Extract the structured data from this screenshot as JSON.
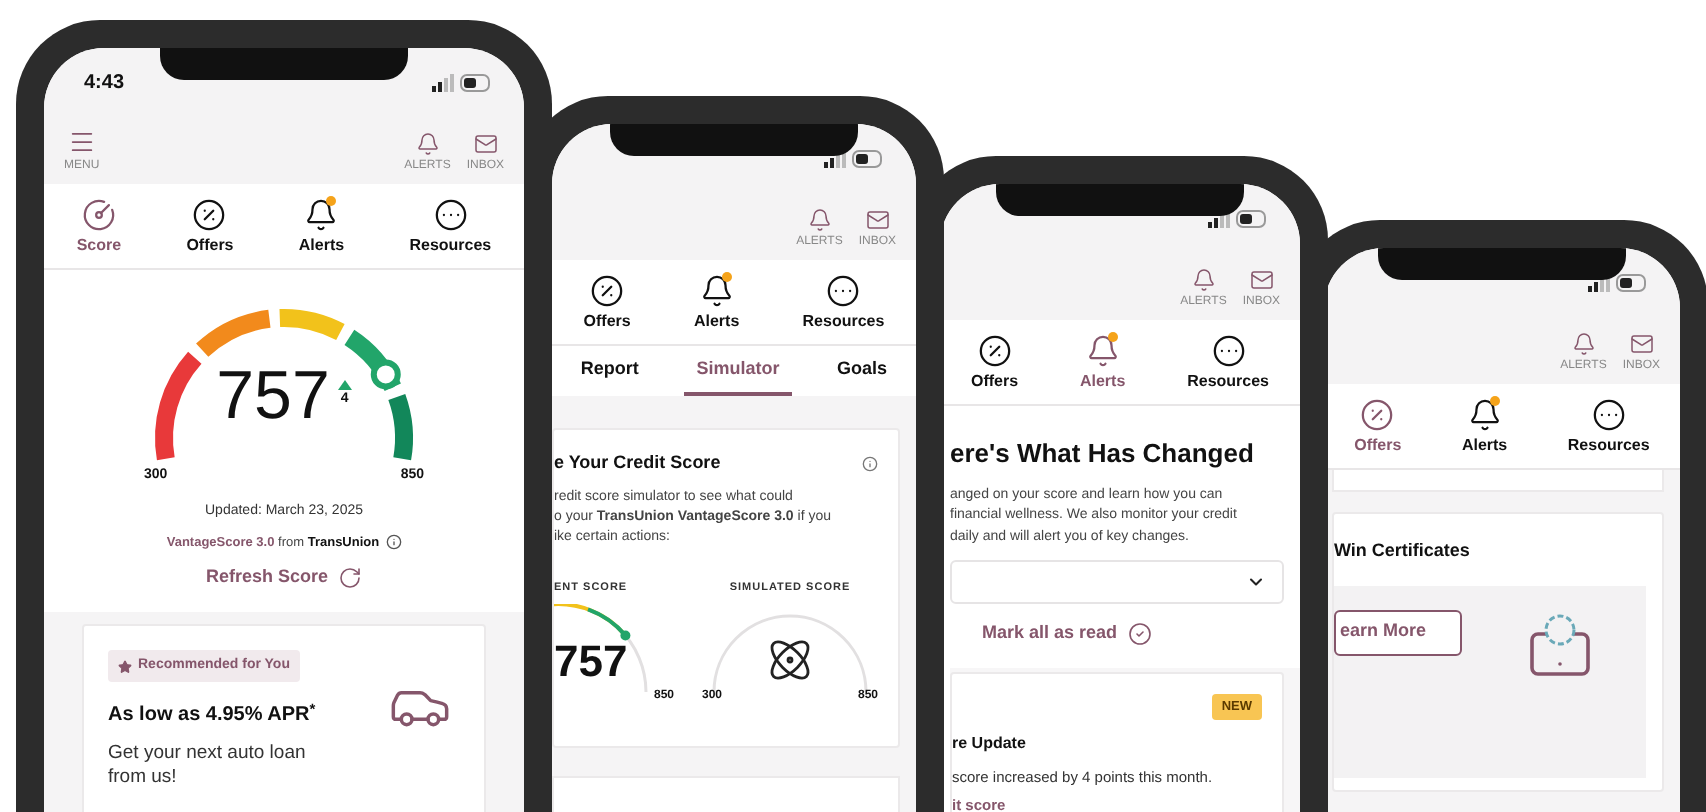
{
  "phones": [
    {
      "kind": "score",
      "status": {
        "time": "4:43"
      },
      "header": {
        "menu": "MENU",
        "alerts": "ALERTS",
        "inbox": "INBOX"
      },
      "nav": [
        {
          "kind": "score",
          "label": "Score",
          "selected": true,
          "notification": false
        },
        {
          "kind": "offers",
          "label": "Offers",
          "selected": false,
          "notification": false
        },
        {
          "kind": "alerts",
          "label": "Alerts",
          "selected": false,
          "notification": true
        },
        {
          "kind": "resources",
          "label": "Resources",
          "selected": false,
          "notification": false
        }
      ],
      "score": {
        "value": "757",
        "change": "4",
        "min": "300",
        "max": "850",
        "updated": "Updated: March 23, 2025",
        "model": "VantageScore 3.0",
        "from": "from",
        "bureau": "TransUnion",
        "refresh": "Refresh Score"
      },
      "offer": {
        "badge": "Recommended for You",
        "title": "As low as 4.95% APR$^{*}$",
        "text": "Get your next auto loan from us!"
      }
    },
    {
      "kind": "simulator",
      "header": {
        "alerts": "ALERTS",
        "inbox": "INBOX"
      },
      "nav": [
        {
          "kind": "offers",
          "label": "Offers",
          "selected": false,
          "notification": false
        },
        {
          "kind": "alerts",
          "label": "Alerts",
          "selected": false,
          "notification": true
        },
        {
          "kind": "resources",
          "label": "Resources",
          "selected": false,
          "notification": false
        }
      ],
      "tabs": [
        {
          "label": "Report",
          "selected": false
        },
        {
          "label": "Simulator",
          "selected": true
        },
        {
          "label": "Goals",
          "selected": false
        }
      ],
      "card": {
        "title": "e Your Credit Score",
        "lines": [
          "redit score simulator to see what could",
          "o your **TransUnion VantageScore 3.0** if you",
          "ike certain actions:"
        ],
        "current": {
          "label": "ENT SCORE",
          "value": "757",
          "max": "850"
        },
        "simulated": {
          "label": "SIMULATED SCORE",
          "min": "300",
          "max": "850"
        }
      }
    },
    {
      "kind": "alerts",
      "header": {
        "alerts": "ALERTS",
        "inbox": "INBOX"
      },
      "nav": [
        {
          "kind": "offers",
          "label": "Offers",
          "selected": false,
          "notification": false
        },
        {
          "kind": "alerts",
          "label": "Alerts",
          "selected": true,
          "notification": true
        },
        {
          "kind": "resources",
          "label": "Resources",
          "selected": false,
          "notification": false
        }
      ],
      "title": "ere's What Has Changed",
      "lines": [
        "anged on your score and learn how you can",
        "financial wellness. We also monitor your credit",
        "daily and will alert you of key changes."
      ],
      "mark_read": "Mark all as read",
      "update": {
        "badge": "NEW",
        "title": "re Update",
        "text": "score increased by 4 points this month.",
        "link": "it score"
      }
    },
    {
      "kind": "offers",
      "header": {
        "alerts": "ALERTS",
        "inbox": "INBOX"
      },
      "nav": [
        {
          "kind": "offers",
          "label": "Offers",
          "selected": true,
          "notification": false
        },
        {
          "kind": "alerts",
          "label": "Alerts",
          "selected": false,
          "notification": true
        },
        {
          "kind": "resources",
          "label": "Resources",
          "selected": false,
          "notification": false
        }
      ],
      "card": {
        "title": "Win Certificates",
        "button": "earn More"
      }
    }
  ]
}
